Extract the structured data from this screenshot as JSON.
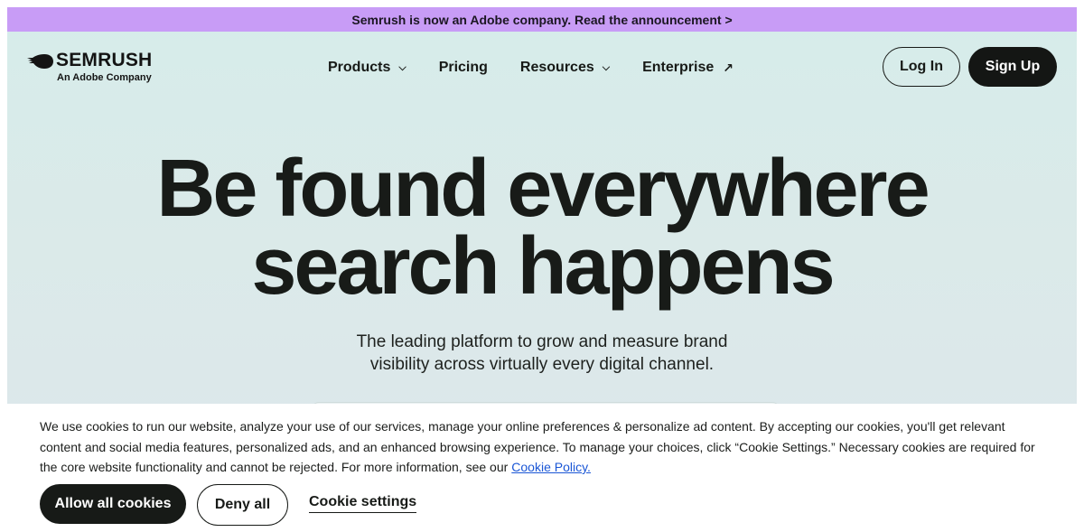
{
  "announcement": {
    "text": "Semrush is now an Adobe company. Read the announcement >"
  },
  "header": {
    "logo": {
      "name": "SEMRUSH",
      "tagline": "An Adobe Company",
      "icon": "semrush-fireball-icon"
    },
    "nav": [
      {
        "label": "Products",
        "icon": "chevron-down-icon"
      },
      {
        "label": "Pricing"
      },
      {
        "label": "Resources",
        "icon": "chevron-down-icon"
      },
      {
        "label": "Enterprise",
        "icon": "external-arrow-icon"
      }
    ],
    "login_label": "Log In",
    "signup_label": "Sign Up"
  },
  "hero": {
    "title_line1": "Be found everywhere",
    "title_line2": "search happens",
    "subtitle_line1": "The leading platform to grow and measure brand",
    "subtitle_line2": "visibility across virtually every digital channel."
  },
  "cookie_banner": {
    "text": "We use cookies to run our website, analyze your use of our services, manage your online preferences & personalize ad content. By accepting our cookies, you'll get relevant content and social media features, personalized ads, and an enhanced browsing experience. To manage your choices, click “Cookie Settings.” Necessary cookies are required for the core website functionality and cannot be rejected. For more information, see our",
    "policy_link": "Cookie Policy.",
    "allow_label": "Allow all cookies",
    "deny_label": "Deny all",
    "settings_label": "Cookie settings"
  },
  "colors": {
    "announcement_bg": "#c89cf6",
    "hero_bg": "#d6ecea",
    "primary_dark": "#171a17",
    "link_blue": "#1a56d6"
  }
}
